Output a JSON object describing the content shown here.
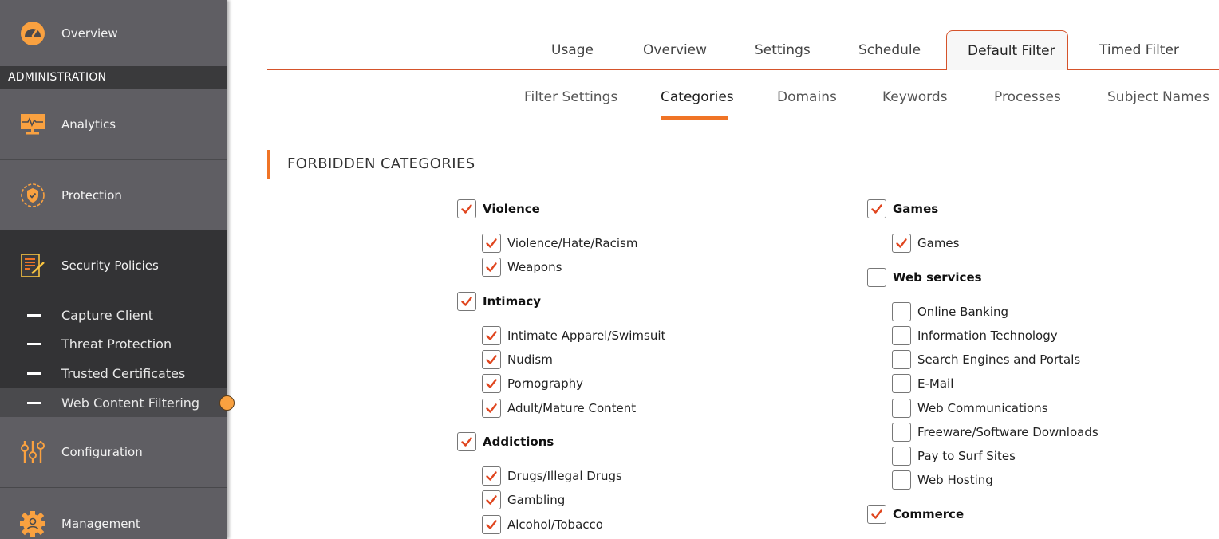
{
  "sidebar": {
    "overview_label": "Overview",
    "admin_header": "ADMINISTRATION",
    "analytics_label": "Analytics",
    "protection_label": "Protection",
    "security_policies_label": "Security Policies",
    "sub_items": [
      {
        "label": "Capture Client",
        "active": false
      },
      {
        "label": "Threat Protection",
        "active": false
      },
      {
        "label": "Trusted Certificates",
        "active": false
      },
      {
        "label": "Web Content Filtering",
        "active": true
      }
    ],
    "configuration_label": "Configuration",
    "management_label": "Management",
    "icon_color": "#f9a140"
  },
  "top_tabs": [
    {
      "label": "Usage",
      "active": false
    },
    {
      "label": "Overview",
      "active": false
    },
    {
      "label": "Settings",
      "active": false
    },
    {
      "label": "Schedule",
      "active": false
    },
    {
      "label": "Default Filter",
      "active": true
    },
    {
      "label": "Timed Filter",
      "active": false
    }
  ],
  "sub_tabs": [
    {
      "label": "Filter Settings",
      "active": false
    },
    {
      "label": "Categories",
      "active": true
    },
    {
      "label": "Domains",
      "active": false
    },
    {
      "label": "Keywords",
      "active": false
    },
    {
      "label": "Processes",
      "active": false
    },
    {
      "label": "Subject Names",
      "active": false
    }
  ],
  "section_title": "FORBIDDEN CATEGORIES",
  "accent_color": "#f07426",
  "check_color": "#e0461f",
  "categories": {
    "left": [
      {
        "name": "Violence",
        "checked": true,
        "children": [
          {
            "name": "Violence/Hate/Racism",
            "checked": true
          },
          {
            "name": "Weapons",
            "checked": true
          }
        ]
      },
      {
        "name": "Intimacy",
        "checked": true,
        "children": [
          {
            "name": "Intimate Apparel/Swimsuit",
            "checked": true
          },
          {
            "name": "Nudism",
            "checked": true
          },
          {
            "name": "Pornography",
            "checked": true
          },
          {
            "name": "Adult/Mature Content",
            "checked": true
          }
        ]
      },
      {
        "name": "Addictions",
        "checked": true,
        "children": [
          {
            "name": "Drugs/Illegal Drugs",
            "checked": true
          },
          {
            "name": "Gambling",
            "checked": true
          },
          {
            "name": "Alcohol/Tobacco",
            "checked": true
          }
        ]
      }
    ],
    "right": [
      {
        "name": "Games",
        "checked": true,
        "children": [
          {
            "name": "Games",
            "checked": true
          }
        ]
      },
      {
        "name": "Web services",
        "checked": false,
        "children": [
          {
            "name": "Online Banking",
            "checked": false
          },
          {
            "name": "Information Technology",
            "checked": false
          },
          {
            "name": "Search Engines and Portals",
            "checked": false
          },
          {
            "name": "E-Mail",
            "checked": false
          },
          {
            "name": "Web Communications",
            "checked": false
          },
          {
            "name": "Freeware/Software Downloads",
            "checked": false
          },
          {
            "name": "Pay to Surf Sites",
            "checked": false
          },
          {
            "name": "Web Hosting",
            "checked": false
          }
        ]
      },
      {
        "name": "Commerce",
        "checked": true,
        "children": []
      }
    ]
  }
}
